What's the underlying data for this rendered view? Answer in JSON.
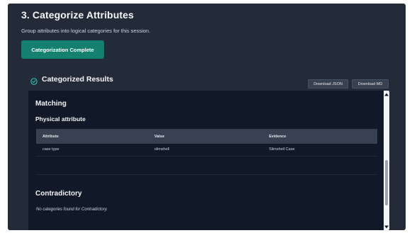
{
  "section": {
    "title": "3. Categorize Attributes",
    "description": "Group attributes into logical categories for this session.",
    "complete_button": "Categorization Complete"
  },
  "results": {
    "title": "Categorized Results",
    "download_json": "Download JSON",
    "download_md": "Download MD",
    "icons": {
      "header": "check-circle-icon"
    },
    "colors": {
      "accent": "#14806f",
      "panel": "#232b39",
      "box": "#111827"
    },
    "matching": {
      "title": "Matching",
      "category": "Physical attribute",
      "table": {
        "headers": [
          "Attribute",
          "Value",
          "Evidence"
        ],
        "rows": [
          [
            "case type",
            "slimshell",
            "Slimshell Case"
          ]
        ]
      }
    },
    "contradictory": {
      "title": "Contradictory",
      "empty_text": "No categories found for Contradictory."
    }
  }
}
